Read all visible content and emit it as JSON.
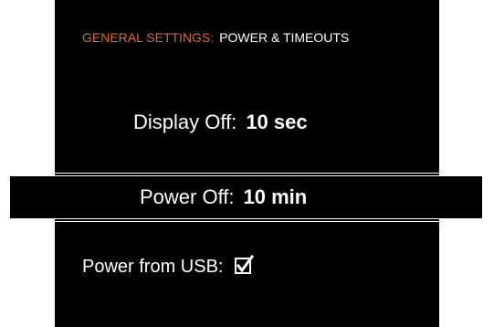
{
  "header": {
    "section": "GENERAL SETTINGS:",
    "page": "POWER & TIMEOUTS"
  },
  "settings": {
    "display_off": {
      "label": "Display Off:",
      "value": "10 sec"
    },
    "power_off": {
      "label": "Power Off:",
      "value": "10 min"
    },
    "power_from_usb": {
      "label": "Power from USB:",
      "checked": true
    }
  },
  "colors": {
    "background": "#000000",
    "accent": "#e06a2c",
    "text": "#ffffff"
  },
  "icons": {
    "usb_checkbox": "checkbox-checked-icon"
  }
}
